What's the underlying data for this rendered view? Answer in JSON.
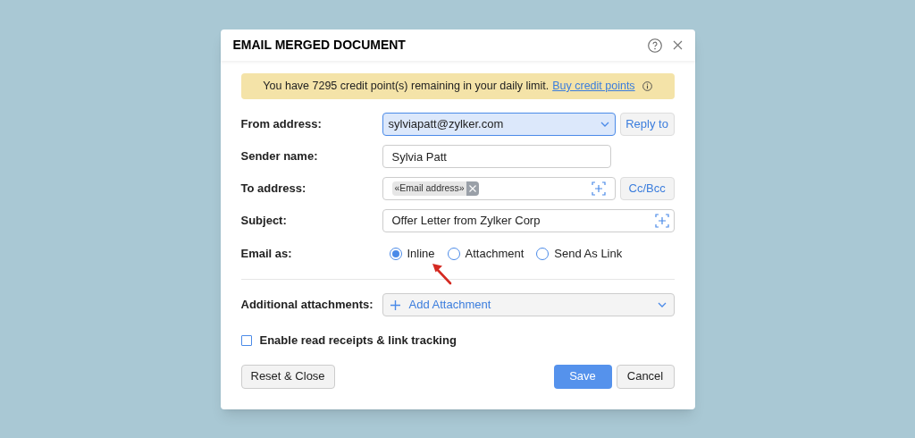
{
  "dialog": {
    "title": "EMAIL MERGED DOCUMENT"
  },
  "banner": {
    "text": "You have 7295 credit point(s) remaining in your daily limit.",
    "link": "Buy credit points"
  },
  "from_address": {
    "label": "From address:",
    "value": "sylviapatt@zylker.com",
    "button": "Reply to"
  },
  "sender_name": {
    "label": "Sender name:",
    "value": "Sylvia Patt"
  },
  "to_address": {
    "label": "To address:",
    "tokens": [
      "«Email address»"
    ],
    "button": "Cc/Bcc"
  },
  "subject": {
    "label": "Subject:",
    "value": "Offer Letter from Zylker Corp"
  },
  "email_as": {
    "label": "Email as:",
    "options": [
      {
        "label": "Inline",
        "selected": true
      },
      {
        "label": "Attachment",
        "selected": false
      },
      {
        "label": "Send As Link",
        "selected": false
      }
    ]
  },
  "additional_attachments": {
    "label": "Additional attachments:",
    "button": "Add Attachment"
  },
  "read_receipts": {
    "label": "Enable read receipts & link tracking",
    "checked": false
  },
  "buttons": {
    "reset": "Reset & Close",
    "save": "Save",
    "cancel": "Cancel"
  }
}
